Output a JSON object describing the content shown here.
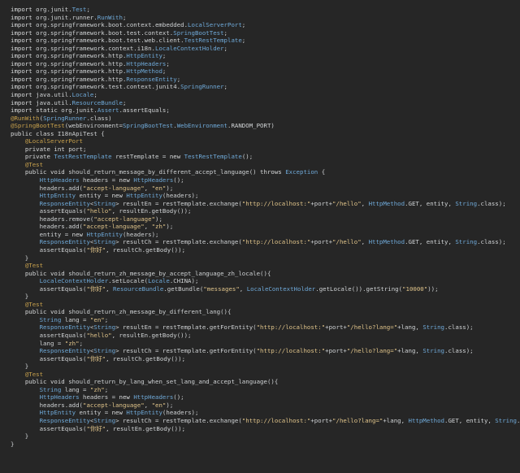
{
  "colors": {
    "background": "#262626",
    "plain": "#cfd2d4",
    "keyword": "#d8dadb",
    "type": "#6fa9d8",
    "string": "#e0c48a",
    "annotation": "#c7a04c"
  },
  "lines": [
    [
      [
        "k",
        "import"
      ],
      [
        "p",
        " org.junit."
      ],
      [
        "t",
        "Test"
      ],
      [
        "p",
        ";"
      ]
    ],
    [
      [
        "k",
        "import"
      ],
      [
        "p",
        " org.junit.runner."
      ],
      [
        "t",
        "RunWith"
      ],
      [
        "p",
        ";"
      ]
    ],
    [
      [
        "k",
        "import"
      ],
      [
        "p",
        " org.springframework.boot.context.embedded."
      ],
      [
        "t",
        "LocalServerPort"
      ],
      [
        "p",
        ";"
      ]
    ],
    [
      [
        "k",
        "import"
      ],
      [
        "p",
        " org.springframework.boot.test.context."
      ],
      [
        "t",
        "SpringBootTest"
      ],
      [
        "p",
        ";"
      ]
    ],
    [
      [
        "k",
        "import"
      ],
      [
        "p",
        " org.springframework.boot.test.web.client."
      ],
      [
        "t",
        "TestRestTemplate"
      ],
      [
        "p",
        ";"
      ]
    ],
    [
      [
        "k",
        "import"
      ],
      [
        "p",
        " org.springframework.context.i18n."
      ],
      [
        "t",
        "LocaleContextHolder"
      ],
      [
        "p",
        ";"
      ]
    ],
    [
      [
        "k",
        "import"
      ],
      [
        "p",
        " org.springframework.http."
      ],
      [
        "t",
        "HttpEntity"
      ],
      [
        "p",
        ";"
      ]
    ],
    [
      [
        "k",
        "import"
      ],
      [
        "p",
        " org.springframework.http."
      ],
      [
        "t",
        "HttpHeaders"
      ],
      [
        "p",
        ";"
      ]
    ],
    [
      [
        "k",
        "import"
      ],
      [
        "p",
        " org.springframework.http."
      ],
      [
        "t",
        "HttpMethod"
      ],
      [
        "p",
        ";"
      ]
    ],
    [
      [
        "k",
        "import"
      ],
      [
        "p",
        " org.springframework.http."
      ],
      [
        "t",
        "ResponseEntity"
      ],
      [
        "p",
        ";"
      ]
    ],
    [
      [
        "k",
        "import"
      ],
      [
        "p",
        " org.springframework.test.context.junit4."
      ],
      [
        "t",
        "SpringRunner"
      ],
      [
        "p",
        ";"
      ]
    ],
    [
      [
        "k",
        "import"
      ],
      [
        "p",
        " java.util."
      ],
      [
        "t",
        "Locale"
      ],
      [
        "p",
        ";"
      ]
    ],
    [
      [
        "k",
        "import"
      ],
      [
        "p",
        " java.util."
      ],
      [
        "t",
        "ResourceBundle"
      ],
      [
        "p",
        ";"
      ]
    ],
    [
      [
        "k",
        "import static"
      ],
      [
        "p",
        " org.junit."
      ],
      [
        "t",
        "Assert"
      ],
      [
        "p",
        ".assertEquals;"
      ]
    ],
    [
      [
        "a",
        "@RunWith"
      ],
      [
        "p",
        "("
      ],
      [
        "t",
        "SpringRunner"
      ],
      [
        "p",
        ".class)"
      ]
    ],
    [
      [
        "a",
        "@SpringBootTest"
      ],
      [
        "p",
        "(webEnvironment="
      ],
      [
        "t",
        "SpringBootTest"
      ],
      [
        "p",
        "."
      ],
      [
        "t",
        "WebEnvironment"
      ],
      [
        "p",
        ".RANDOM_PORT)"
      ]
    ],
    [
      [
        "k",
        "public class"
      ],
      [
        "p",
        " I18nApiTest {"
      ]
    ],
    [
      [
        "p",
        "    "
      ],
      [
        "a",
        "@LocalServerPort"
      ]
    ],
    [
      [
        "p",
        "    "
      ],
      [
        "k",
        "private int"
      ],
      [
        "p",
        " port;"
      ]
    ],
    [
      [
        "p",
        "    "
      ],
      [
        "k",
        "private"
      ],
      [
        "p",
        " "
      ],
      [
        "t",
        "TestRestTemplate"
      ],
      [
        "p",
        " restTemplate = "
      ],
      [
        "k",
        "new"
      ],
      [
        "p",
        " "
      ],
      [
        "t",
        "TestRestTemplate"
      ],
      [
        "p",
        "();"
      ]
    ],
    [
      [
        "p",
        "    "
      ],
      [
        "a",
        "@Test"
      ]
    ],
    [
      [
        "p",
        "    "
      ],
      [
        "k",
        "public void"
      ],
      [
        "p",
        " should_return_message_by_different_accept_language() "
      ],
      [
        "k",
        "throws"
      ],
      [
        "p",
        " "
      ],
      [
        "t",
        "Exception"
      ],
      [
        "p",
        " {"
      ]
    ],
    [
      [
        "p",
        "        "
      ],
      [
        "t",
        "HttpHeaders"
      ],
      [
        "p",
        " headers = "
      ],
      [
        "k",
        "new"
      ],
      [
        "p",
        " "
      ],
      [
        "t",
        "HttpHeaders"
      ],
      [
        "p",
        "();"
      ]
    ],
    [
      [
        "p",
        "        headers.add("
      ],
      [
        "s",
        "\"accept-language\""
      ],
      [
        "p",
        ", "
      ],
      [
        "s",
        "\"en\""
      ],
      [
        "p",
        ");"
      ]
    ],
    [
      [
        "p",
        "        "
      ],
      [
        "t",
        "HttpEntity"
      ],
      [
        "p",
        " entity = "
      ],
      [
        "k",
        "new"
      ],
      [
        "p",
        " "
      ],
      [
        "t",
        "HttpEntity"
      ],
      [
        "p",
        "(headers);"
      ]
    ],
    [
      [
        "p",
        "        "
      ],
      [
        "t",
        "ResponseEntity"
      ],
      [
        "p",
        "<"
      ],
      [
        "t",
        "String"
      ],
      [
        "p",
        "> resultEn = restTemplate.exchange("
      ],
      [
        "s",
        "\"http://localhost:\""
      ],
      [
        "p",
        "+port+"
      ],
      [
        "s",
        "\"/hello\""
      ],
      [
        "p",
        ", "
      ],
      [
        "t",
        "HttpMethod"
      ],
      [
        "p",
        ".GET, entity, "
      ],
      [
        "t",
        "String"
      ],
      [
        "p",
        ".class);"
      ]
    ],
    [
      [
        "p",
        "        assertEquals("
      ],
      [
        "s",
        "\"hello\""
      ],
      [
        "p",
        ", resultEn.getBody());"
      ]
    ],
    [
      [
        "p",
        "        headers.remove("
      ],
      [
        "s",
        "\"accept-language\""
      ],
      [
        "p",
        ");"
      ]
    ],
    [
      [
        "p",
        "        headers.add("
      ],
      [
        "s",
        "\"accept-language\""
      ],
      [
        "p",
        ", "
      ],
      [
        "s",
        "\"zh\""
      ],
      [
        "p",
        ");"
      ]
    ],
    [
      [
        "p",
        "        entity = "
      ],
      [
        "k",
        "new"
      ],
      [
        "p",
        " "
      ],
      [
        "t",
        "HttpEntity"
      ],
      [
        "p",
        "(headers);"
      ]
    ],
    [
      [
        "p",
        "        "
      ],
      [
        "t",
        "ResponseEntity"
      ],
      [
        "p",
        "<"
      ],
      [
        "t",
        "String"
      ],
      [
        "p",
        "> resultCh = restTemplate.exchange("
      ],
      [
        "s",
        "\"http://localhost:\""
      ],
      [
        "p",
        "+port+"
      ],
      [
        "s",
        "\"/hello\""
      ],
      [
        "p",
        ", "
      ],
      [
        "t",
        "HttpMethod"
      ],
      [
        "p",
        ".GET, entity, "
      ],
      [
        "t",
        "String"
      ],
      [
        "p",
        ".class);"
      ]
    ],
    [
      [
        "p",
        "        assertEquals("
      ],
      [
        "s",
        "\"你好\""
      ],
      [
        "p",
        ", resultCh.getBody());"
      ]
    ],
    [
      [
        "p",
        "    }"
      ]
    ],
    [
      [
        "p",
        "    "
      ],
      [
        "a",
        "@Test"
      ]
    ],
    [
      [
        "p",
        "    "
      ],
      [
        "k",
        "public void"
      ],
      [
        "p",
        " should_return_zh_message_by_accept_language_zh_locale(){"
      ]
    ],
    [
      [
        "p",
        "        "
      ],
      [
        "t",
        "LocaleContextHolder"
      ],
      [
        "p",
        ".setLocale("
      ],
      [
        "t",
        "Locale"
      ],
      [
        "p",
        ".CHINA);"
      ]
    ],
    [
      [
        "p",
        "        assertEquals("
      ],
      [
        "s",
        "\"你好\""
      ],
      [
        "p",
        ", "
      ],
      [
        "t",
        "ResourceBundle"
      ],
      [
        "p",
        ".getBundle("
      ],
      [
        "s",
        "\"messages\""
      ],
      [
        "p",
        ", "
      ],
      [
        "t",
        "LocaleContextHolder"
      ],
      [
        "p",
        ".getLocale()).getString("
      ],
      [
        "s",
        "\"10000\""
      ],
      [
        "p",
        "));"
      ]
    ],
    [
      [
        "p",
        "    }"
      ]
    ],
    [
      [
        "p",
        "    "
      ],
      [
        "a",
        "@Test"
      ]
    ],
    [
      [
        "p",
        "    "
      ],
      [
        "k",
        "public void"
      ],
      [
        "p",
        " should_return_zh_message_by_different_lang(){"
      ]
    ],
    [
      [
        "p",
        "        "
      ],
      [
        "t",
        "String"
      ],
      [
        "p",
        " lang = "
      ],
      [
        "s",
        "\"en\""
      ],
      [
        "p",
        ";"
      ]
    ],
    [
      [
        "p",
        "        "
      ],
      [
        "t",
        "ResponseEntity"
      ],
      [
        "p",
        "<"
      ],
      [
        "t",
        "String"
      ],
      [
        "p",
        "> resultEn = restTemplate.getForEntity("
      ],
      [
        "s",
        "\"http://localhost:\""
      ],
      [
        "p",
        "+port+"
      ],
      [
        "s",
        "\"/hello?lang=\""
      ],
      [
        "p",
        "+lang, "
      ],
      [
        "t",
        "String"
      ],
      [
        "p",
        ".class);"
      ]
    ],
    [
      [
        "p",
        "        assertEquals("
      ],
      [
        "s",
        "\"hello\""
      ],
      [
        "p",
        ", resultEn.getBody());"
      ]
    ],
    [
      [
        "p",
        "        lang = "
      ],
      [
        "s",
        "\"zh\""
      ],
      [
        "p",
        ";"
      ]
    ],
    [
      [
        "p",
        "        "
      ],
      [
        "t",
        "ResponseEntity"
      ],
      [
        "p",
        "<"
      ],
      [
        "t",
        "String"
      ],
      [
        "p",
        "> resultCh = restTemplate.getForEntity("
      ],
      [
        "s",
        "\"http://localhost:\""
      ],
      [
        "p",
        "+port+"
      ],
      [
        "s",
        "\"/hello?lang=\""
      ],
      [
        "p",
        "+lang, "
      ],
      [
        "t",
        "String"
      ],
      [
        "p",
        ".class);"
      ]
    ],
    [
      [
        "p",
        "        assertEquals("
      ],
      [
        "s",
        "\"你好\""
      ],
      [
        "p",
        ", resultCh.getBody());"
      ]
    ],
    [
      [
        "p",
        "    }"
      ]
    ],
    [
      [
        "p",
        "    "
      ],
      [
        "a",
        "@Test"
      ]
    ],
    [
      [
        "p",
        "    "
      ],
      [
        "k",
        "public void"
      ],
      [
        "p",
        " should_return_by_lang_when_set_lang_and_accept_language(){"
      ]
    ],
    [
      [
        "p",
        "        "
      ],
      [
        "t",
        "String"
      ],
      [
        "p",
        " lang = "
      ],
      [
        "s",
        "\"zh\""
      ],
      [
        "p",
        ";"
      ]
    ],
    [
      [
        "p",
        "        "
      ],
      [
        "t",
        "HttpHeaders"
      ],
      [
        "p",
        " headers = "
      ],
      [
        "k",
        "new"
      ],
      [
        "p",
        " "
      ],
      [
        "t",
        "HttpHeaders"
      ],
      [
        "p",
        "();"
      ]
    ],
    [
      [
        "p",
        "        headers.add("
      ],
      [
        "s",
        "\"accept-language\""
      ],
      [
        "p",
        ", "
      ],
      [
        "s",
        "\"en\""
      ],
      [
        "p",
        ");"
      ]
    ],
    [
      [
        "p",
        "        "
      ],
      [
        "t",
        "HttpEntity"
      ],
      [
        "p",
        " entity = "
      ],
      [
        "k",
        "new"
      ],
      [
        "p",
        " "
      ],
      [
        "t",
        "HttpEntity"
      ],
      [
        "p",
        "(headers);"
      ]
    ],
    [
      [
        "p",
        "        "
      ],
      [
        "t",
        "ResponseEntity"
      ],
      [
        "p",
        "<"
      ],
      [
        "t",
        "String"
      ],
      [
        "p",
        "> resultCh = restTemplate.exchange("
      ],
      [
        "s",
        "\"http://localhost:\""
      ],
      [
        "p",
        "+port+"
      ],
      [
        "s",
        "\"/hello?lang=\""
      ],
      [
        "p",
        "+lang, "
      ],
      [
        "t",
        "HttpMethod"
      ],
      [
        "p",
        ".GET, entity, "
      ],
      [
        "t",
        "String"
      ],
      [
        "p",
        ".class);"
      ]
    ],
    [
      [
        "p",
        "        assertEquals("
      ],
      [
        "s",
        "\"你好\""
      ],
      [
        "p",
        ", resultEn.getBody());"
      ]
    ],
    [
      [
        "p",
        "    }"
      ]
    ],
    [
      [
        "p",
        "}"
      ]
    ]
  ]
}
